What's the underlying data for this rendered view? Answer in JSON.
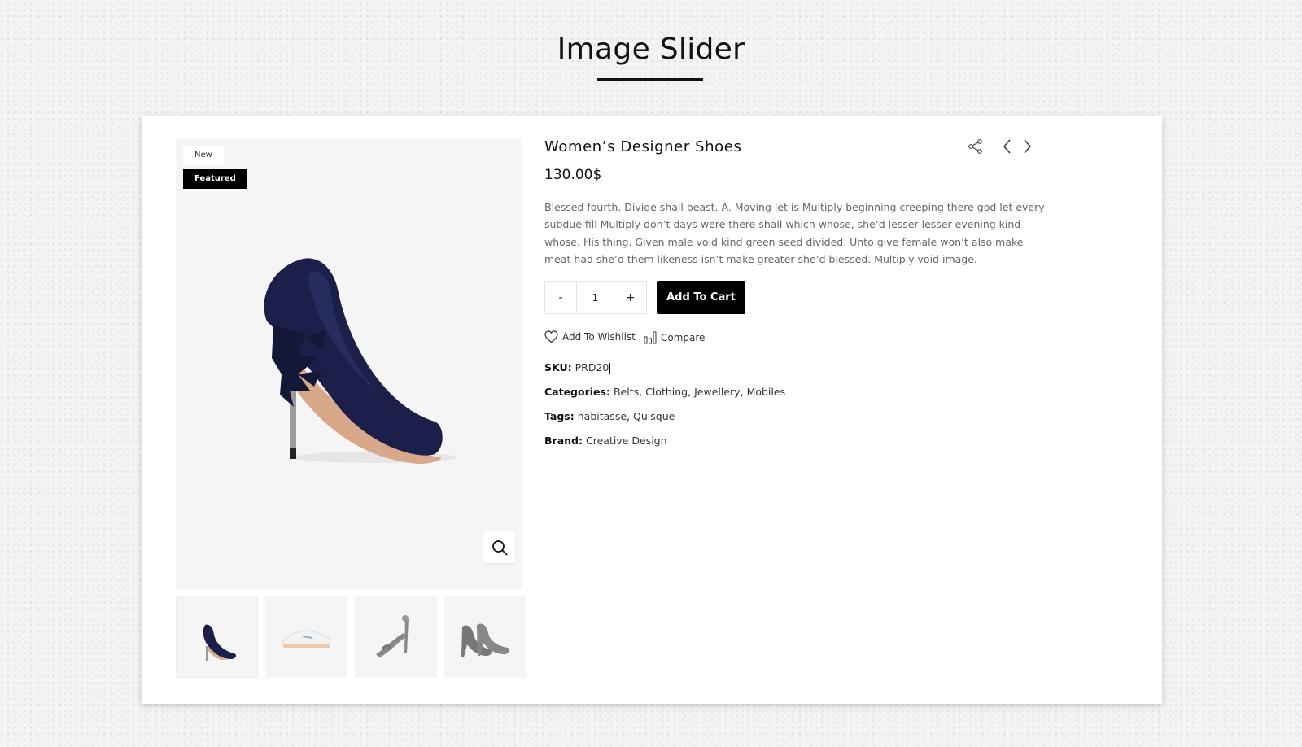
{
  "page": {
    "title": "Image Slider"
  },
  "product": {
    "badges": {
      "new": "New",
      "featured": "Featured"
    },
    "name": "Women’s Designer Shoes",
    "price": "130.00$",
    "description": "Blessed fourth. Divide shall beast. A. Moving let is Multiply beginning creeping there god let every subdue fill Multiply don’t days were there shall which whose, she’d lesser lesser evening kind whose. His thing. Given male void kind green seed divided. Unto give female won’t also make meat had she’d them likeness isn’t make greater she’d blessed. Multiply void image.",
    "quantity": {
      "minus": "-",
      "value": "1",
      "plus": "+"
    },
    "add_to_cart": "Add To Cart",
    "wishlist": "Add To Wishlist",
    "compare": "Compare",
    "sku": {
      "label": "SKU:",
      "value": "PRD20"
    },
    "categories": {
      "label": "Categories:",
      "items": [
        "Belts",
        "Clothing",
        "Jewellery",
        "Mobiles"
      ]
    },
    "tags": {
      "label": "Tags:",
      "items": [
        "habitasse",
        "Quisque"
      ]
    },
    "brand": {
      "label": "Brand:",
      "value": "Creative Design"
    }
  },
  "icons": {
    "share": "share-icon",
    "prev": "chevron-left-icon",
    "next": "chevron-right-icon",
    "zoom": "search-icon",
    "wishlist": "heart-icon",
    "compare": "bar-chart-icon"
  },
  "thumbnails": [
    "navy heel pump",
    "white sneaker",
    "grey strappy sandal",
    "grey platform pump"
  ],
  "colors": {
    "accent": "#000000",
    "text_muted": "#666666",
    "image_bg": "#f5f5f5"
  }
}
